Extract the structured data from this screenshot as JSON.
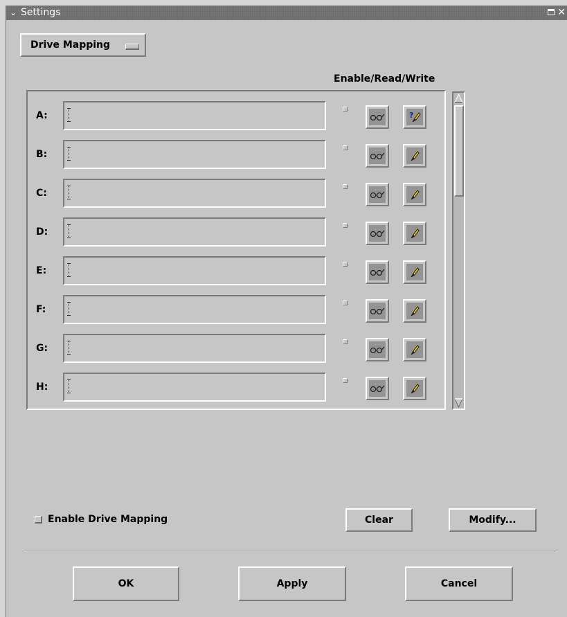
{
  "window": {
    "title": "Settings"
  },
  "dropdown": {
    "selected": "Drive Mapping"
  },
  "list": {
    "column_header": "Enable/Read/Write",
    "rows": [
      {
        "drive": "A:",
        "path": ""
      },
      {
        "drive": "B:",
        "path": ""
      },
      {
        "drive": "C:",
        "path": ""
      },
      {
        "drive": "D:",
        "path": ""
      },
      {
        "drive": "E:",
        "path": ""
      },
      {
        "drive": "F:",
        "path": ""
      },
      {
        "drive": "G:",
        "path": ""
      },
      {
        "drive": "H:",
        "path": ""
      }
    ]
  },
  "icons": {
    "read": "glasses-icon",
    "write": "pencil-icon",
    "write_help": "help-pencil-icon"
  },
  "options": {
    "enable_drive_mapping": "Enable Drive Mapping",
    "enable_drive_mapping_checked": false
  },
  "buttons": {
    "clear": "Clear",
    "modify": "Modify...",
    "ok": "OK",
    "apply": "Apply",
    "cancel": "Cancel"
  }
}
